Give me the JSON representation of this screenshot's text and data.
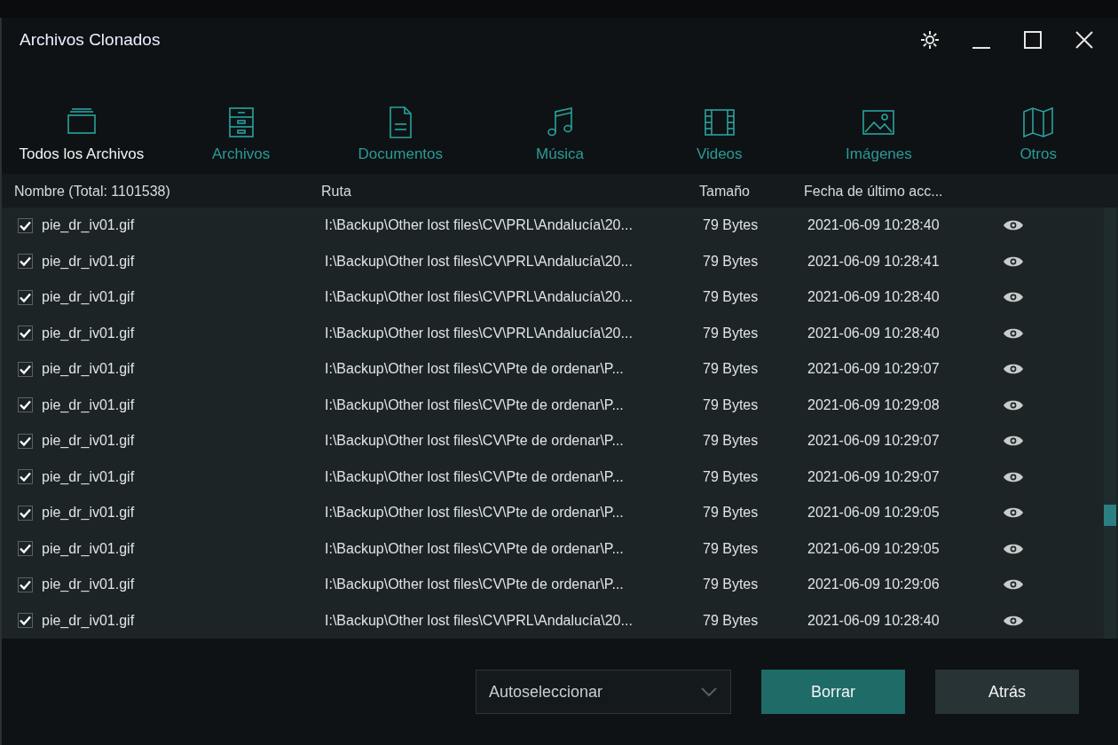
{
  "window": {
    "title": "Archivos Clonados"
  },
  "categories": [
    {
      "label": "Todos los Archivos",
      "kind": "all",
      "selected": true
    },
    {
      "label": "Archivos",
      "kind": "archive",
      "selected": false
    },
    {
      "label": "Documentos",
      "kind": "document",
      "selected": false
    },
    {
      "label": "Música",
      "kind": "music",
      "selected": false
    },
    {
      "label": "Videos",
      "kind": "video",
      "selected": false
    },
    {
      "label": "Imágenes",
      "kind": "image",
      "selected": false
    },
    {
      "label": "Otros",
      "kind": "other",
      "selected": false
    }
  ],
  "table": {
    "columns": [
      "Nombre (Total: 1101538)",
      "Ruta",
      "Tamaño",
      "Fecha de último acc..."
    ],
    "rows": [
      {
        "checked": true,
        "name": "pie_dr_iv01.gif",
        "path": "I:\\Backup\\Other lost files\\CV\\PRL\\Andalucía\\20...",
        "size": "79 Bytes",
        "date": "2021-06-09 10:28:40"
      },
      {
        "checked": true,
        "name": "pie_dr_iv01.gif",
        "path": "I:\\Backup\\Other lost files\\CV\\PRL\\Andalucía\\20...",
        "size": "79 Bytes",
        "date": "2021-06-09 10:28:41"
      },
      {
        "checked": true,
        "name": "pie_dr_iv01.gif",
        "path": "I:\\Backup\\Other lost files\\CV\\PRL\\Andalucía\\20...",
        "size": "79 Bytes",
        "date": "2021-06-09 10:28:40"
      },
      {
        "checked": true,
        "name": "pie_dr_iv01.gif",
        "path": "I:\\Backup\\Other lost files\\CV\\PRL\\Andalucía\\20...",
        "size": "79 Bytes",
        "date": "2021-06-09 10:28:40"
      },
      {
        "checked": true,
        "name": "pie_dr_iv01.gif",
        "path": "I:\\Backup\\Other lost files\\CV\\Pte de ordenar\\P...",
        "size": "79 Bytes",
        "date": "2021-06-09 10:29:07"
      },
      {
        "checked": true,
        "name": "pie_dr_iv01.gif",
        "path": "I:\\Backup\\Other lost files\\CV\\Pte de ordenar\\P...",
        "size": "79 Bytes",
        "date": "2021-06-09 10:29:08"
      },
      {
        "checked": true,
        "name": "pie_dr_iv01.gif",
        "path": "I:\\Backup\\Other lost files\\CV\\Pte de ordenar\\P...",
        "size": "79 Bytes",
        "date": "2021-06-09 10:29:07"
      },
      {
        "checked": true,
        "name": "pie_dr_iv01.gif",
        "path": "I:\\Backup\\Other lost files\\CV\\Pte de ordenar\\P...",
        "size": "79 Bytes",
        "date": "2021-06-09 10:29:07"
      },
      {
        "checked": true,
        "name": "pie_dr_iv01.gif",
        "path": "I:\\Backup\\Other lost files\\CV\\Pte de ordenar\\P...",
        "size": "79 Bytes",
        "date": "2021-06-09 10:29:05"
      },
      {
        "checked": true,
        "name": "pie_dr_iv01.gif",
        "path": "I:\\Backup\\Other lost files\\CV\\Pte de ordenar\\P...",
        "size": "79 Bytes",
        "date": "2021-06-09 10:29:05"
      },
      {
        "checked": true,
        "name": "pie_dr_iv01.gif",
        "path": "I:\\Backup\\Other lost files\\CV\\Pte de ordenar\\P...",
        "size": "79 Bytes",
        "date": "2021-06-09 10:29:06"
      },
      {
        "checked": true,
        "name": "pie_dr_iv01.gif",
        "path": "I:\\Backup\\Other lost files\\CV\\PRL\\Andalucía\\20...",
        "size": "79 Bytes",
        "date": "2021-06-09 10:28:40"
      }
    ]
  },
  "footer": {
    "select": {
      "value": "Autoseleccionar"
    },
    "buttons": [
      {
        "label": "Borrar",
        "kind": "primary"
      },
      {
        "label": "Atrás",
        "kind": "secondary"
      }
    ]
  }
}
